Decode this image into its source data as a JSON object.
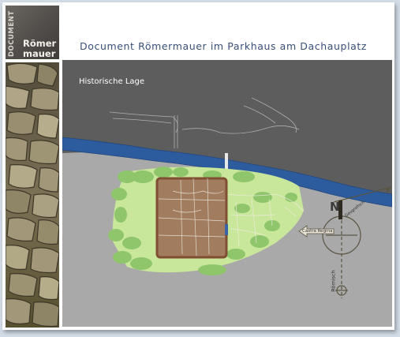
{
  "logo": {
    "vertical_text": "DOCUMENT",
    "line1": "Römer",
    "line2": "mauer"
  },
  "header": {
    "title": "Document Römermauer im Parkhaus am Dachauplatz"
  },
  "map": {
    "subtitle": "Historische Lage",
    "castra_label": "Castra Regina",
    "north_letter": "N",
    "roman_axis_label": "Römisch",
    "geo_axis_label": "Geografisch",
    "colors": {
      "background": "#5e5d5d",
      "river": "#2d5c9e",
      "land": "#a9a9a9",
      "green_area": "#c9e79a",
      "trees": "#8fc66c",
      "fort": "#a17c5e",
      "fort_border": "#7f4e33",
      "compass": "#5a5443"
    }
  }
}
